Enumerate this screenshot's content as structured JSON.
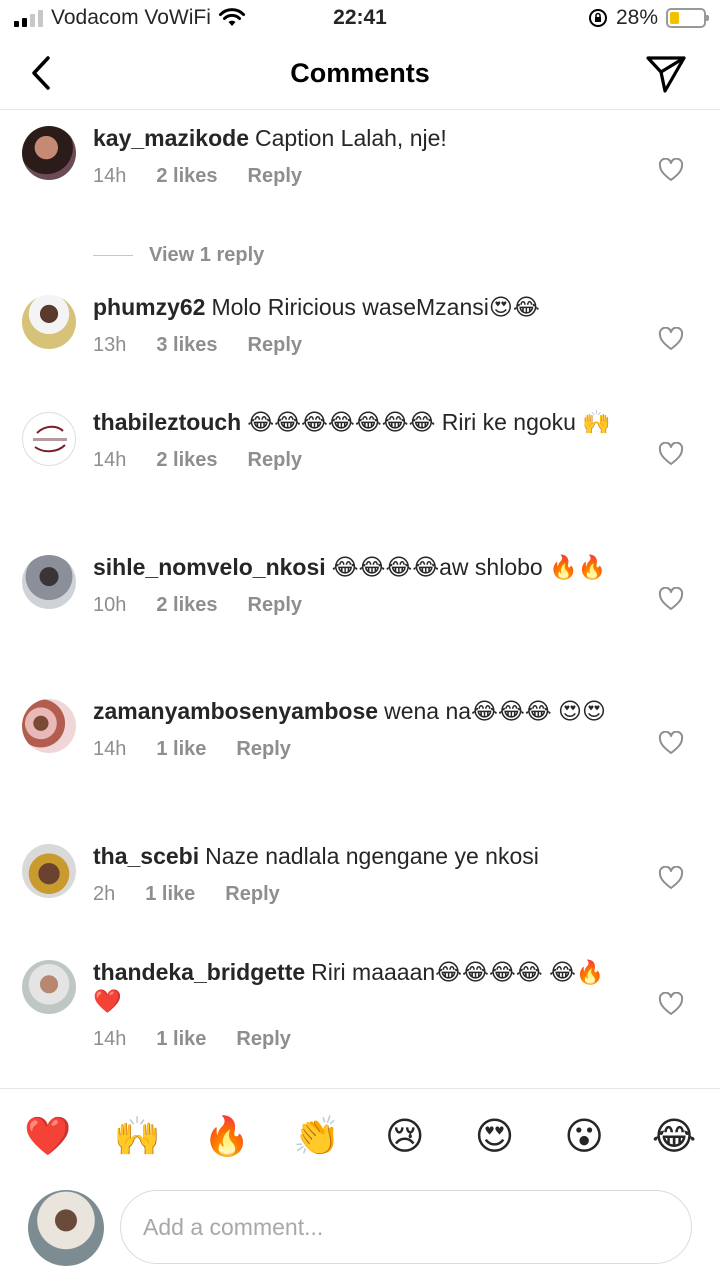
{
  "status_bar": {
    "carrier": "Vodacom VoWiFi",
    "time": "22:41",
    "battery": "28%",
    "battery_level": 0.28
  },
  "nav": {
    "title": "Comments"
  },
  "comments": [
    {
      "user": "kay_mazikode",
      "text": "Caption Lalah, nje!",
      "time": "14h",
      "likes": "2 likes",
      "reply": "Reply",
      "view_replies": "View 1 reply"
    },
    {
      "user": "phumzy62",
      "text": "Molo Riricious waseMzansi😍😂",
      "time": "13h",
      "likes": "3 likes",
      "reply": "Reply"
    },
    {
      "user": "thabileztouch",
      "text": "😂😂😂😂😂😂😂 Riri ke ngoku 🙌",
      "time": "14h",
      "likes": "2 likes",
      "reply": "Reply"
    },
    {
      "user": "sihle_nomvelo_nkosi",
      "text": "😂😂😂😂aw shlobo 🔥🔥",
      "time": "10h",
      "likes": "2 likes",
      "reply": "Reply"
    },
    {
      "user": "zamanyambosenyambose",
      "text": "wena na😂😂😂 😍😍",
      "time": "14h",
      "likes": "1 like",
      "reply": "Reply"
    },
    {
      "user": "tha_scebi",
      "text": "Naze nadlala ngengane ye nkosi",
      "time": "2h",
      "likes": "1 like",
      "reply": "Reply"
    },
    {
      "user": "thandeka_bridgette",
      "text": "Riri maaaan😂😂😂😂 😂🔥❤️",
      "time": "14h",
      "likes": "1 like",
      "reply": "Reply"
    }
  ],
  "reactions": [
    "❤️",
    "🙌",
    "🔥",
    "👏",
    "😢",
    "😍",
    "😮",
    "😂"
  ],
  "composer": {
    "placeholder": "Add a comment..."
  },
  "colors": {
    "text": "#262626",
    "secondary": "#8e8e8e",
    "battery": "#f2c200"
  }
}
